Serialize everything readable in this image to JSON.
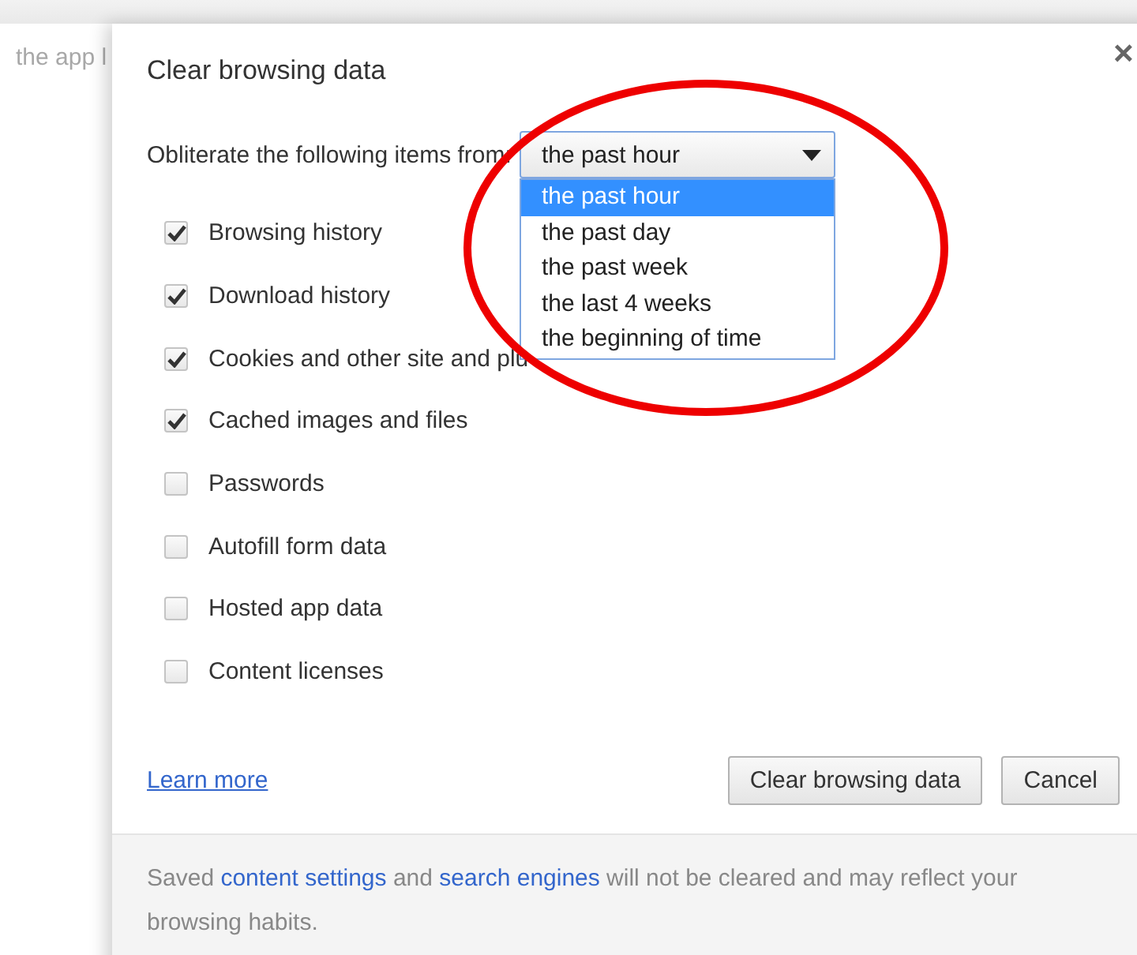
{
  "background_text": "the app l",
  "dialog": {
    "title": "Clear browsing data",
    "close": "×",
    "period_label": "Obliterate the following items from:",
    "period_select": {
      "value": "the past hour",
      "expanded": true,
      "options": [
        {
          "label": "the past hour",
          "selected": true
        },
        {
          "label": "the past day",
          "selected": false
        },
        {
          "label": "the past week",
          "selected": false
        },
        {
          "label": "the last 4 weeks",
          "selected": false
        },
        {
          "label": "the beginning of time",
          "selected": false
        }
      ]
    },
    "items": [
      {
        "label": "Browsing history",
        "checked": true
      },
      {
        "label": "Download history",
        "checked": true
      },
      {
        "label": "Cookies and other site and plu",
        "checked": true
      },
      {
        "label": "Cached images and files",
        "checked": true
      },
      {
        "label": "Passwords",
        "checked": false
      },
      {
        "label": "Autofill form data",
        "checked": false
      },
      {
        "label": "Hosted app data",
        "checked": false
      },
      {
        "label": "Content licenses",
        "checked": false
      }
    ],
    "learn_more": "Learn more",
    "buttons": [
      "Clear browsing data",
      "Cancel"
    ],
    "footer": [
      {
        "text": "Saved ",
        "kind": "text"
      },
      {
        "text": "content settings",
        "kind": "link"
      },
      {
        "text": " and ",
        "kind": "text"
      },
      {
        "text": "search engines",
        "kind": "link"
      },
      {
        "text": " will not be cleared and may reflect your browsing habits.",
        "kind": "text"
      }
    ]
  },
  "annotation": {
    "kind": "ellipse",
    "color": "#ee0000"
  }
}
